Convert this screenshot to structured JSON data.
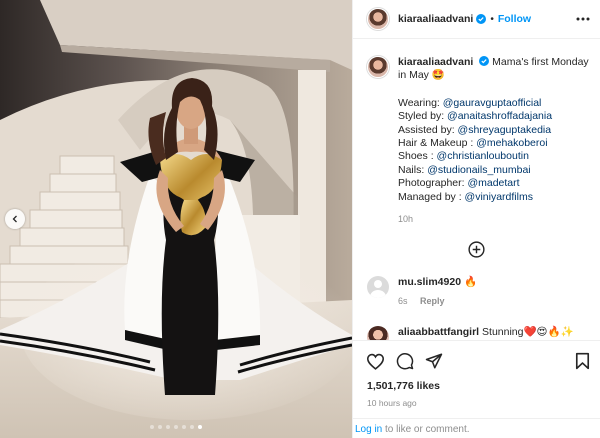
{
  "post": {
    "username": "kiaraaliaadvani",
    "follow_label": "Follow",
    "separator": "•",
    "verified_icon": "verified-badge-icon",
    "more_icon": "more-options-icon",
    "carousel": {
      "slide_count": 7,
      "active_index": 6,
      "prev_icon": "chevron-left-icon"
    }
  },
  "caption": {
    "username": "kiaraaliaadvani",
    "text": "Mama's first Monday in May 🤩",
    "credits": [
      {
        "label": "Wearing: ",
        "mention": "@gauravguptaofficial"
      },
      {
        "label": "Styled by: ",
        "mention": "@anaitashroffadajania"
      },
      {
        "label": "Assisted by: ",
        "mention": "@shreyaguptakedia"
      },
      {
        "label": "Hair & Makeup : ",
        "mention": "@mehakoberoi"
      },
      {
        "label": "Shoes : ",
        "mention": "@christianlouboutin"
      },
      {
        "label": "Nails: ",
        "mention": "@studionails_mumbai"
      },
      {
        "label": "Photographer: ",
        "mention": "@madetart"
      },
      {
        "label": "Managed by : ",
        "mention": "@viniyardfilms"
      }
    ],
    "time": "10h",
    "load_more_icon": "plus-circle-icon"
  },
  "comments": [
    {
      "username": "mu.slim4920",
      "text": " 🔥",
      "time": "6s",
      "reply_label": "Reply"
    },
    {
      "username": "aliaabbattfangirl",
      "text": " Stunning❤️😍🔥✨"
    }
  ],
  "actions": {
    "like_icon": "heart-icon",
    "comment_icon": "comment-icon",
    "share_icon": "share-icon",
    "save_icon": "bookmark-icon",
    "likes": "1,501,776 likes",
    "posted": "10 hours ago"
  },
  "login": {
    "link": "Log in",
    "rest": " to like or comment."
  },
  "colors": {
    "link_blue": "#0095f6",
    "mention_blue": "#00376b",
    "muted": "#8e8e8e",
    "text": "#262626"
  }
}
